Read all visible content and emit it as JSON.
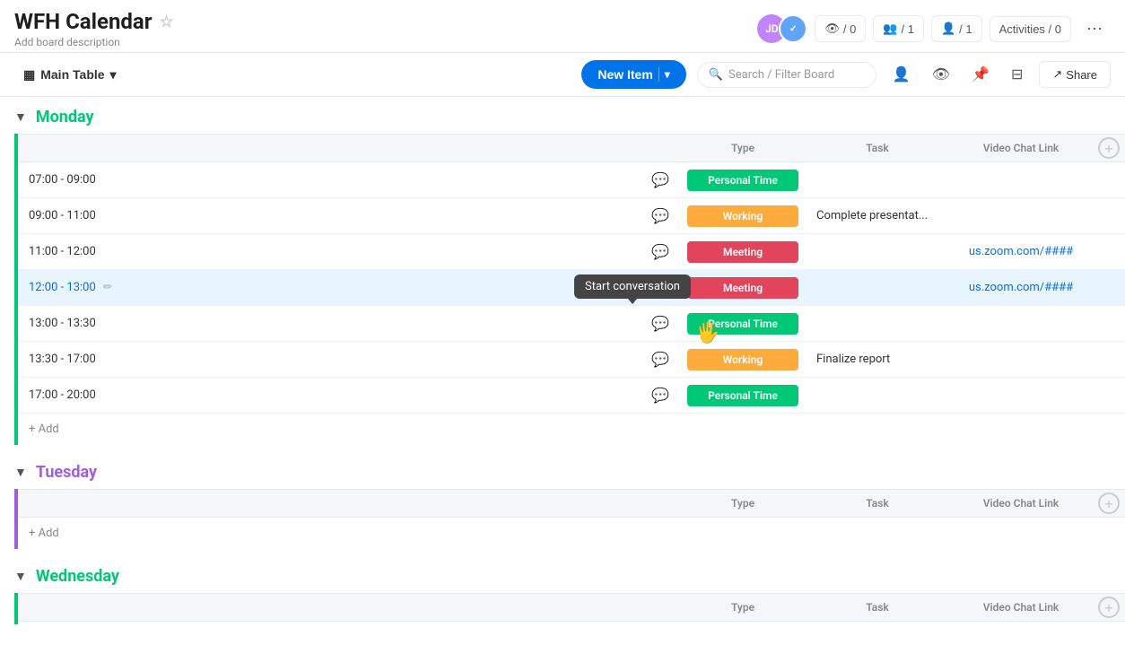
{
  "header": {
    "title": "WFH Calendar",
    "description": "Add board description",
    "star_icon": "★",
    "avatar_initials": "JD",
    "avatar2_initials": "👤",
    "invite_count": "/ 0",
    "guest_count": "/ 1",
    "member_count": "/ 1",
    "activities_label": "Activities / 0",
    "more_icon": "⋯"
  },
  "toolbar": {
    "main_table_label": "Main Table",
    "new_item_label": "New Item",
    "search_placeholder": "Search / Filter Board",
    "share_label": "Share"
  },
  "groups": [
    {
      "id": "monday",
      "title": "Monday",
      "color": "monday",
      "columns": [
        "Type",
        "Task",
        "Video Chat Link"
      ],
      "rows": [
        {
          "time": "07:00 - 09:00",
          "type": "Personal Time",
          "type_class": "type-personal",
          "task": "",
          "link": ""
        },
        {
          "time": "09:00 - 11:00",
          "type": "Working",
          "type_class": "type-working",
          "task": "Complete presentat...",
          "link": ""
        },
        {
          "time": "11:00 - 12:00",
          "type": "Meeting",
          "type_class": "type-meeting",
          "task": "",
          "link": "us.zoom.com/####",
          "has_tooltip": true
        },
        {
          "time": "12:00 - 13:00",
          "type": "Meeting",
          "type_class": "type-meeting",
          "task": "",
          "link": "us.zoom.com/####",
          "is_active": true,
          "has_chat_active": true
        },
        {
          "time": "13:00 - 13:30",
          "type": "Personal Time",
          "type_class": "type-personal",
          "task": "",
          "link": ""
        },
        {
          "time": "13:30 - 17:00",
          "type": "Working",
          "type_class": "type-working",
          "task": "Finalize report",
          "link": ""
        },
        {
          "time": "17:00 - 20:00",
          "type": "Personal Time",
          "type_class": "type-personal",
          "task": "",
          "link": ""
        }
      ]
    },
    {
      "id": "tuesday",
      "title": "Tuesday",
      "color": "tuesday",
      "columns": [
        "Type",
        "Task",
        "Video Chat Link"
      ],
      "rows": []
    },
    {
      "id": "wednesday",
      "title": "Wednesday",
      "color": "wednesday",
      "columns": [
        "Type",
        "Task",
        "Video Chat Link"
      ],
      "rows": []
    }
  ],
  "tooltip": {
    "label": "Start conversation"
  },
  "icons": {
    "star": "☆",
    "table": "▦",
    "chevron_down": "▾",
    "search": "🔍",
    "person": "👤",
    "eye": "👁",
    "pin": "📌",
    "filter": "⊟",
    "share_arrow": "↗",
    "chat": "💬",
    "plus": "+",
    "edit": "✏"
  }
}
